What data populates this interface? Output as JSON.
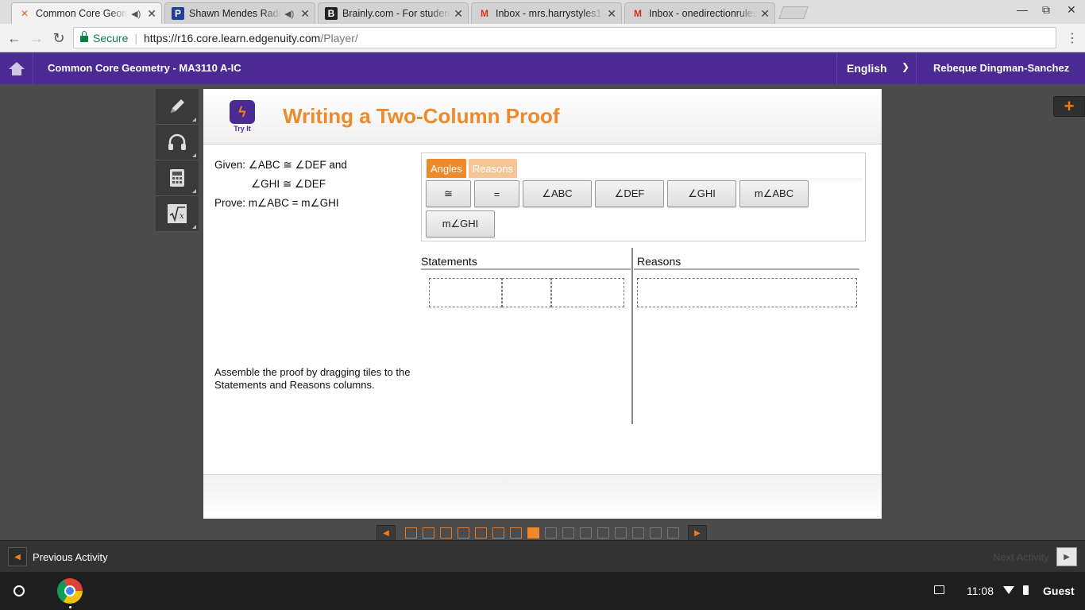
{
  "browser": {
    "tabs": [
      {
        "title": "Common Core Geom",
        "favicon": "edgenuity-x-icon",
        "audio": true
      },
      {
        "title": "Shawn Mendes Radio",
        "favicon": "pandora-p-icon",
        "audio": true
      },
      {
        "title": "Brainly.com - For studen",
        "favicon": "brainly-b-icon",
        "audio": false
      },
      {
        "title": "Inbox - mrs.harrystyles1",
        "favicon": "gmail-m-icon",
        "audio": false
      },
      {
        "title": "Inbox - onedirectionrules",
        "favicon": "gmail-m-icon",
        "audio": false
      }
    ],
    "secure_label": "Secure",
    "url_host": "https://r16.core.learn.edgenuity.com",
    "url_path": "/Player/"
  },
  "header": {
    "course": "Common Core Geometry - MA3110 A-IC",
    "language": "English",
    "user": "Rebeque Dingman-Sanchez"
  },
  "activity": {
    "badge": "Try It",
    "title": "Writing a Two-Column Proof",
    "given_label": "Given:",
    "given_1": "∠ABC ≅ ∠DEF and",
    "given_2": "∠GHI ≅ ∠DEF",
    "prove_label": "Prove:",
    "prove": "m∠ABC = m∠GHI",
    "instructions": "Assemble the proof by dragging tiles to the Statements and Reasons columns."
  },
  "tile_tabs": [
    "Angles",
    "Reasons"
  ],
  "tiles": [
    "≅",
    "=",
    "∠ABC",
    "∠DEF",
    "∠GHI",
    "m∠ABC",
    "m∠GHI"
  ],
  "proof": {
    "statements_header": "Statements",
    "reasons_header": "Reasons"
  },
  "pager": {
    "total": 16,
    "current": 8
  },
  "nav": {
    "previous": "Previous Activity",
    "next": "Next Activity"
  },
  "shelf": {
    "time": "11:08",
    "user": "Guest"
  },
  "colors": {
    "brand_purple": "#4b2a93",
    "accent_orange": "#ef8a2a"
  }
}
